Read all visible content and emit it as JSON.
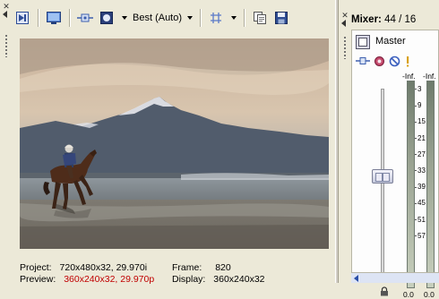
{
  "toolbar": {
    "quality_label": "Best (Auto)",
    "icons": [
      "split-screen-icon",
      "preview-external-monitor-icon",
      "video-fx-icon",
      "preview-toggle-icon",
      "grid-overlay-icon",
      "copy-snapshot-icon",
      "save-snapshot-icon"
    ]
  },
  "status": {
    "project_label": "Project:",
    "project_value": "720x480x32, 29.970i",
    "frame_label": "Frame:",
    "frame_value": "820",
    "preview_label": "Preview:",
    "preview_value": "360x240x32, 29.970p",
    "display_label": "Display:",
    "display_value": "360x240x32"
  },
  "mixer": {
    "title_label": "Mixer:",
    "title_value": "44 / 16",
    "master_label": "Master",
    "peak_left": "-Inf.",
    "peak_right": "-Inf.",
    "scale": [
      "3",
      "9",
      "15",
      "21",
      "27",
      "33",
      "39",
      "45",
      "51",
      "57"
    ],
    "level_left": "0.0",
    "level_right": "0.0"
  },
  "colors": {
    "panel_bg": "#ece9d8",
    "preview_red": "#c00000"
  }
}
